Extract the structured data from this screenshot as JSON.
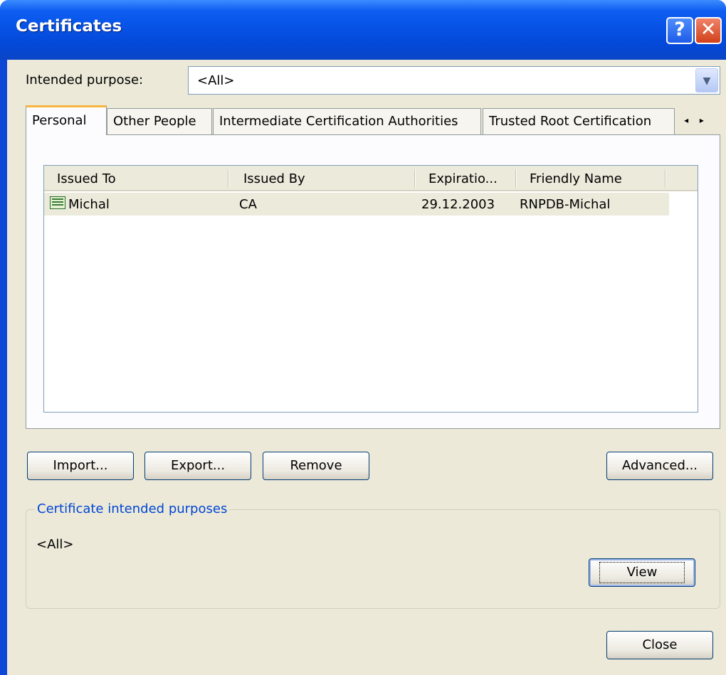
{
  "window": {
    "title": "Certificates",
    "help_icon": "?",
    "close_icon": "✕"
  },
  "purpose": {
    "label": "Intended purpose:",
    "value": "<All>",
    "arrow_icon": "chevron-down-icon"
  },
  "tabs": [
    {
      "label": "Personal",
      "active": true
    },
    {
      "label": "Other People",
      "active": false
    },
    {
      "label": "Intermediate Certification Authorities",
      "active": false
    },
    {
      "label": "Trusted Root Certification",
      "active": false
    }
  ],
  "tab_scroll": "◂ ▸",
  "list": {
    "columns": [
      "Issued To",
      "Issued By",
      "Expiratio...",
      "Friendly Name"
    ],
    "rows": [
      {
        "issued_to": "Michal",
        "issued_by": "CA",
        "expiration": "29.12.2003",
        "friendly_name": "RNPDB-Michal"
      }
    ]
  },
  "buttons": {
    "import": "Import...",
    "export": "Export...",
    "remove": "Remove",
    "advanced": "Advanced...",
    "view": "View",
    "close": "Close"
  },
  "group": {
    "title": "Certificate intended purposes",
    "value": "<All>"
  },
  "colors": {
    "titlebar": "#0653e6",
    "dialog_bg": "#ece9d8",
    "group_title": "#0046d5",
    "active_tab_accent": "#f6b640"
  }
}
